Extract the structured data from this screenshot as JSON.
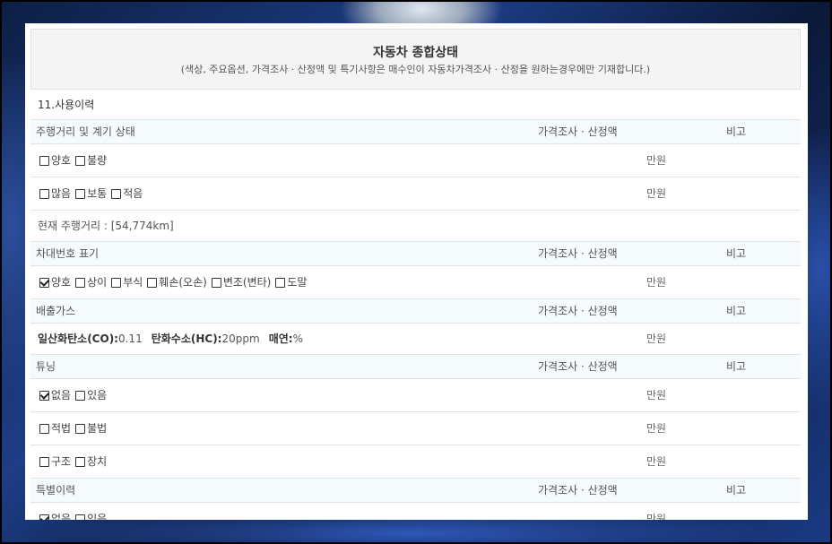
{
  "header": {
    "title": "자동차 종합상태",
    "subtitle": "(색상, 주요옵션, 가격조사 · 산정액 및 특기사항은 매수인이 자동차가격조사 · 산정을 원하는경우에만 기재합니다.)"
  },
  "section": {
    "title": "11.사용이력"
  },
  "columns": {
    "price": "가격조사 · 산정액",
    "note": "비고",
    "unit": "만원"
  },
  "mileage_group": {
    "label": "주행거리 및 계기 상태",
    "row1": {
      "opt1": "양호",
      "opt2": "불량"
    },
    "row2": {
      "opt1": "많음",
      "opt2": "보통",
      "opt3": "적음"
    },
    "current": "현재 주행거리 : [54,774km]"
  },
  "plate_group": {
    "label": "차대번호 표기",
    "options": {
      "o1": "양호",
      "o2": "상이",
      "o3": "부식",
      "o4": "훼손(오손)",
      "o5": "변조(변타)",
      "o6": "도말"
    },
    "checked": "양호"
  },
  "emission_group": {
    "label": "배출가스",
    "co_label": "일산화탄소(CO):",
    "co_value": "0.11",
    "hc_label": "탄화수소(HC):",
    "hc_value": "20ppm",
    "smoke_label": "매연:",
    "smoke_value": "%"
  },
  "tuning_group": {
    "label": "튜닝",
    "row1": {
      "opt1": "없음",
      "opt2": "있음"
    },
    "row2": {
      "opt1": "적법",
      "opt2": "불법"
    },
    "row3": {
      "opt1": "구조",
      "opt2": "장치"
    },
    "checked": "없음"
  },
  "special_group": {
    "label": "특별이력",
    "row1": {
      "opt1": "없음",
      "opt2": "있음"
    },
    "checked": "없음"
  }
}
